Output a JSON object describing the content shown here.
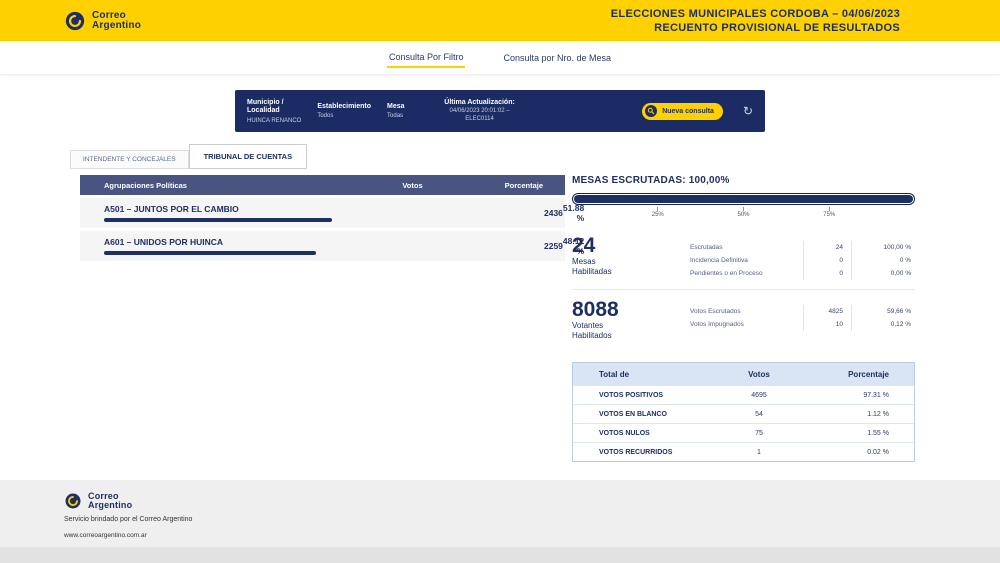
{
  "colors": {
    "yellow": "#FFD100",
    "navy": "#1E2F63",
    "table_header_navy": "#495480",
    "light_blue_header": "#D9E5F4"
  },
  "header": {
    "brand_line1": "Correo",
    "brand_line2": "Argentino",
    "title_line1": "ELECCIONES MUNICIPALES CORDOBA – 04/06/2023",
    "title_line2": "RECUENTO PROVISIONAL DE RESULTADOS"
  },
  "topnav": {
    "filter_tab": "Consulta Por Filtro",
    "mesa_tab": "Consulta por Nro. de Mesa"
  },
  "filter_bar": {
    "municipio_label_line1": "Municipio /",
    "municipio_label_line2": "Localidad",
    "municipio_value": "HUINCA RENANCO",
    "establecimiento_label": "Establecimiento",
    "establecimiento_value": "Todos",
    "mesa_label": "Mesa",
    "mesa_value": "Todas",
    "update_label": "Última Actualización:",
    "update_value": "04/06/2023 20:01:02 –",
    "update_code": "ELEC0114",
    "new_query_button": "Nueva consulta",
    "refresh_icon": "↻"
  },
  "section_tabs": {
    "tab1": "INTENDENTE Y CONCEJALES",
    "tab2": "TRIBUNAL DE CUENTAS"
  },
  "results_table": {
    "headers": {
      "name": "Agrupaciones Políticas",
      "votes": "Votos",
      "pct": "Porcentaje"
    },
    "rows": [
      {
        "name": "A501 – JUNTOS POR EL CAMBIO",
        "votes": "2436",
        "pct": "51.88 %",
        "bar_pct": 51.88
      },
      {
        "name": "A601 – UNIDOS POR HUINCA",
        "votes": "2259",
        "pct": "48.12 %",
        "bar_pct": 48.12
      }
    ]
  },
  "escrutadas": {
    "title": "MESAS ESCRUTADAS: 100,00%",
    "progress_pct": 100,
    "scale": [
      "25%",
      "50%",
      "75%"
    ]
  },
  "mesas": {
    "big_number": "24",
    "label_line1": "Mesas",
    "label_line2": "Habilitadas",
    "rows": [
      {
        "label": "Escrutadas",
        "value": "24",
        "pct": "100,00 %"
      },
      {
        "label": "Incidencia Definitiva",
        "value": "0",
        "pct": "0 %"
      },
      {
        "label": "Pendientes o en Proceso",
        "value": "0",
        "pct": "0,00 %"
      }
    ]
  },
  "votantes": {
    "big_number": "8088",
    "label_line1": "Votantes",
    "label_line2": "Habilitados",
    "rows": [
      {
        "label": "Votos Escrutados",
        "value": "4825",
        "pct": "59,66 %"
      },
      {
        "label": "Votos Impugnados",
        "value": "10",
        "pct": "0,12 %"
      }
    ]
  },
  "totals_table": {
    "headers": {
      "label": "Total de",
      "votes": "Votos",
      "pct": "Porcentaje"
    },
    "rows": [
      {
        "label": "VOTOS POSITIVOS",
        "votes": "4695",
        "pct": "97.31 %"
      },
      {
        "label": "VOTOS EN BLANCO",
        "votes": "54",
        "pct": "1.12 %"
      },
      {
        "label": "VOTOS NULOS",
        "votes": "75",
        "pct": "1.55 %"
      },
      {
        "label": "VOTOS RECURRIDOS",
        "votes": "1",
        "pct": "0.02 %"
      }
    ]
  },
  "footer": {
    "brand_line1": "Correo",
    "brand_line2": "Argentino",
    "service_text": "Servicio brindado por el Correo Argentino",
    "url": "www.correoargentino.com.ar"
  }
}
